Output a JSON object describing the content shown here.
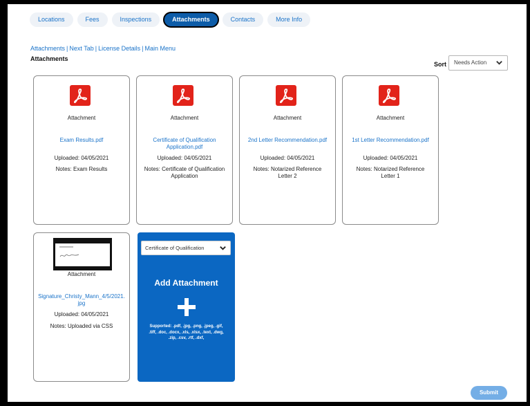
{
  "tabs": [
    {
      "label": "Locations",
      "active": false
    },
    {
      "label": "Fees",
      "active": false
    },
    {
      "label": "Inspections",
      "active": false
    },
    {
      "label": "Attachments",
      "active": true
    },
    {
      "label": "Contacts",
      "active": false
    },
    {
      "label": "More Info",
      "active": false
    }
  ],
  "breadcrumb": [
    "Attachments",
    "Next Tab",
    "License Details",
    "Main Menu"
  ],
  "breadcrumb_separator": "|",
  "page_title": "Attachments",
  "sort": {
    "label": "Sort",
    "value": "Needs Action"
  },
  "cards": [
    {
      "type_label": "Attachment",
      "file_name": "Exam Results.pdf",
      "uploaded": "Uploaded: 04/05/2021",
      "notes": "Notes: Exam Results"
    },
    {
      "type_label": "Attachment",
      "file_name": "Certificate of Qualification Application.pdf",
      "uploaded": "Uploaded: 04/05/2021",
      "notes": "Notes: Certificate of Qualification Application"
    },
    {
      "type_label": "Attachment",
      "file_name": "2nd Letter Recommendation.pdf",
      "uploaded": "Uploaded: 04/05/2021",
      "notes": "Notes: Notarized Reference Letter 2"
    },
    {
      "type_label": "Attachment",
      "file_name": "1st Letter Recommendation.pdf",
      "uploaded": "Uploaded: 04/05/2021",
      "notes": "Notes: Notarized Reference Letter 1"
    },
    {
      "type_label": "Attachment",
      "file_name": "Signature_Christy_Mann_4/5/2021.jpg",
      "uploaded": "Uploaded: 04/05/2021",
      "notes": "Notes: Uploaded via CSS"
    }
  ],
  "add_attachment": {
    "selected_type": "Certificate of Qualification",
    "title": "Add Attachment",
    "supported": "Supported: .pdf, .jpg, .png, .jpeg, .gif, .tiff, .doc, .docx, .xls, .xlsx, .text, .dwg, .zip, .csv, .rtf, .dxf,"
  },
  "submit_label": "Submit",
  "icons": {
    "file": "pdf-file-icon",
    "image": "image-thumbnail",
    "dropdown": "chevron-down-icon",
    "add": "plus-icon"
  },
  "colors": {
    "link": "#1a73c9",
    "primary": "#0b67c2",
    "active_tab": "#0d5ca8",
    "pdf": "#e2231a",
    "submit": "#74aee6"
  }
}
